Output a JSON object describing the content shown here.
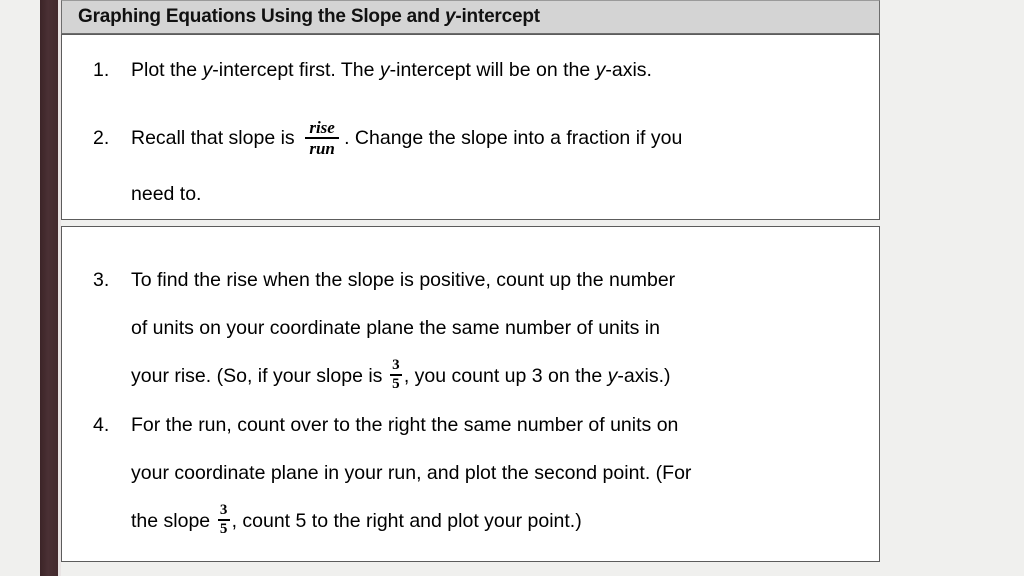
{
  "slide": {
    "title": {
      "before_italic": "Graphing Equations Using the Slope and ",
      "italic": "y",
      "after_italic": "-intercept"
    },
    "background_color": "#f0f0ee",
    "accent_bar_color": "#452b2e",
    "title_band_color": "#d4d4d4",
    "box_background_color": "#ffffff",
    "box_border_color": "#5c5c5c"
  },
  "box1": {
    "steps": [
      {
        "marker": "1.",
        "lines": [
          {
            "segments": [
              {
                "type": "text",
                "value": "Plot the "
              },
              {
                "type": "italic",
                "value": "y"
              },
              {
                "type": "text",
                "value": "-intercept first. The "
              },
              {
                "type": "italic",
                "value": "y"
              },
              {
                "type": "text",
                "value": "-intercept will be on the "
              },
              {
                "type": "italic",
                "value": "y"
              },
              {
                "type": "text",
                "value": "-axis."
              }
            ]
          }
        ]
      },
      {
        "marker": "2.",
        "lines": [
          {
            "segments": [
              {
                "type": "text",
                "value": "Recall that slope is "
              },
              {
                "type": "fraction",
                "numerator": "rise",
                "denominator": "run"
              },
              {
                "type": "text",
                "value": ". Change the slope into a fraction if you"
              }
            ]
          },
          {
            "segments": [
              {
                "type": "text",
                "value": "need to."
              }
            ]
          }
        ]
      }
    ]
  },
  "box2": {
    "steps": [
      {
        "marker": "3.",
        "lines": [
          {
            "segments": [
              {
                "type": "text",
                "value": "To find the rise when the slope is positive, count up the number"
              }
            ]
          },
          {
            "segments": [
              {
                "type": "text",
                "value": "of units on your coordinate plane the same number of units in"
              }
            ]
          },
          {
            "segments": [
              {
                "type": "text",
                "value": "your rise. (So, if your slope is "
              },
              {
                "type": "fraction-small",
                "numerator": "3",
                "denominator": "5"
              },
              {
                "type": "text",
                "value": ", you count up 3 on the "
              },
              {
                "type": "italic",
                "value": "y"
              },
              {
                "type": "text",
                "value": "-axis.)"
              }
            ]
          }
        ]
      },
      {
        "marker": "4.",
        "lines": [
          {
            "segments": [
              {
                "type": "text",
                "value": "For the run, count over to the right the same number of units on"
              }
            ]
          },
          {
            "segments": [
              {
                "type": "text",
                "value": "your coordinate plane in your run, and plot the second point. (For"
              }
            ]
          },
          {
            "segments": [
              {
                "type": "text",
                "value": "the slope "
              },
              {
                "type": "fraction-small",
                "numerator": "3",
                "denominator": "5"
              },
              {
                "type": "text",
                "value": ", count 5 to the right and plot your point.)"
              }
            ]
          }
        ]
      }
    ]
  }
}
